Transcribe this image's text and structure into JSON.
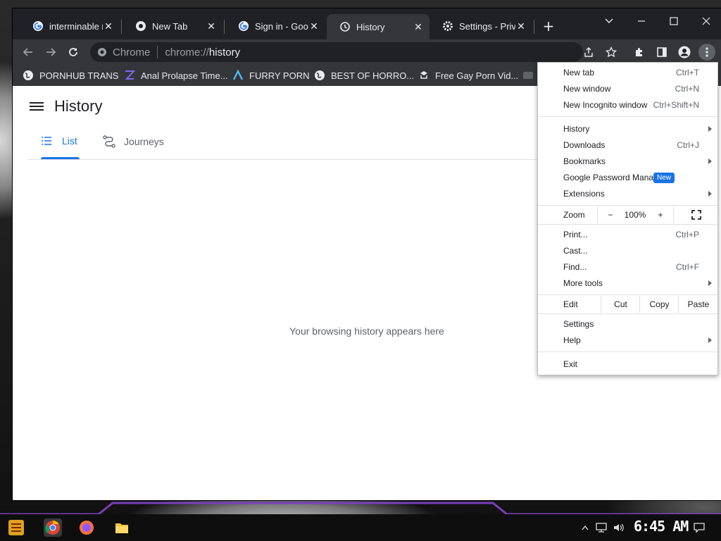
{
  "tabs": [
    {
      "title": "interminable r",
      "icon": "google-g-icon",
      "active": false
    },
    {
      "title": "New Tab",
      "icon": "chrome-icon",
      "active": false
    },
    {
      "title": "Sign in - Googl",
      "icon": "google-g-icon",
      "active": false
    },
    {
      "title": "History",
      "icon": "history-icon",
      "active": true
    },
    {
      "title": "Settings - Priv",
      "icon": "gear-icon",
      "active": false
    }
  ],
  "omnibox": {
    "site_chip": "Chrome",
    "scheme": "chrome://",
    "path": "history"
  },
  "bookmarks": [
    {
      "label": "PORNHUB TRANS",
      "icon": "globe-icon"
    },
    {
      "label": "Anal Prolapse Time...",
      "icon": "purple-z-icon"
    },
    {
      "label": "FURRY PORN",
      "icon": "blue-lambda-icon"
    },
    {
      "label": "BEST OF HORRO...",
      "icon": "globe-icon"
    },
    {
      "label": "Free Gay Porn Vid...",
      "icon": "anchor-icon"
    }
  ],
  "page": {
    "title": "History",
    "tabs": {
      "list": "List",
      "journeys": "Journeys"
    },
    "empty_message": "Your browsing history appears here"
  },
  "menu": {
    "new_tab": {
      "label": "New tab",
      "shortcut": "Ctrl+T"
    },
    "new_window": {
      "label": "New window",
      "shortcut": "Ctrl+N"
    },
    "new_incognito": {
      "label": "New Incognito window",
      "shortcut": "Ctrl+Shift+N"
    },
    "history": "History",
    "downloads": {
      "label": "Downloads",
      "shortcut": "Ctrl+J"
    },
    "bookmarks": "Bookmarks",
    "password_manager": "Google Password Manager",
    "new_badge": "New",
    "extensions": "Extensions",
    "zoom": {
      "label": "Zoom",
      "minus": "−",
      "value": "100%",
      "plus": "+"
    },
    "print": {
      "label": "Print...",
      "shortcut": "Ctrl+P"
    },
    "cast": "Cast...",
    "find": {
      "label": "Find...",
      "shortcut": "Ctrl+F"
    },
    "more_tools": "More tools",
    "edit": {
      "label": "Edit",
      "cut": "Cut",
      "copy": "Copy",
      "paste": "Paste"
    },
    "settings": "Settings",
    "help": "Help",
    "exit": "Exit"
  },
  "taskbar": {
    "clock": "6:45 AM"
  },
  "colors": {
    "accent": "#1a73e8",
    "tab_bg": "#35363a",
    "frame": "#202124",
    "taskbar_accent": "#7b3fb8"
  }
}
